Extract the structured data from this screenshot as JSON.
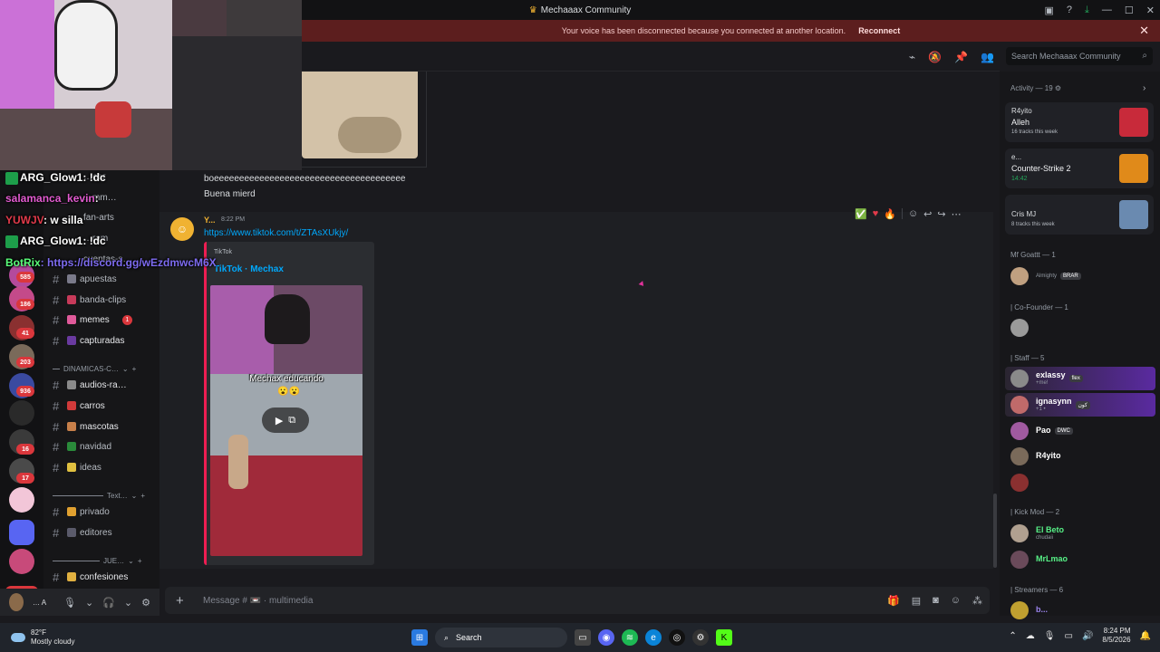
{
  "window": {
    "title": "Mechaaax Community"
  },
  "banner": {
    "message": "Your voice has been disconnected because you connected at another location.",
    "action": "Reconnect"
  },
  "search": {
    "placeholder": "Search Mechaaax Community"
  },
  "stream_chat": [
    {
      "user": "ARG_Glow1",
      "text": ": !dc"
    },
    {
      "user": "salamanca_kevin",
      "text": ":"
    },
    {
      "user": "YUWJV",
      "text": ": w silla"
    },
    {
      "user": "ARG_Glow1",
      "text": ": !dc"
    },
    {
      "user": "BotRix",
      "text": ": https://discord.gg/wEzdmwcM6X"
    }
  ],
  "guild_badges": [
    "585",
    "186",
    "41",
    "203",
    "936",
    "16",
    "17"
  ],
  "guild_new": "NEW",
  "channels": {
    "partial_top": [
      "…ear",
      "…mm…",
      "fan-arts",
      "…ram",
      "cuentas-s…"
    ],
    "items": [
      {
        "name": "apuestas"
      },
      {
        "name": "banda-clips"
      },
      {
        "name": "memes",
        "badge": "1"
      },
      {
        "name": "capturadas"
      },
      {
        "name": "audios-ra…"
      },
      {
        "name": "carros"
      },
      {
        "name": "mascotas"
      },
      {
        "name": "navidad"
      },
      {
        "name": "ideas"
      },
      {
        "name": "privado"
      },
      {
        "name": "editores"
      },
      {
        "name": "confesiones"
      }
    ],
    "categories": [
      "DINAMICAS-C…",
      "Text…",
      "JUE…"
    ]
  },
  "user_panel": {
    "name": "…",
    "sub": "A"
  },
  "messages": {
    "line1": "boeeeeeeeeeeeeeeeeeeeeeeeeeeeeeeeeeeeeee",
    "line2": "Buena mierd",
    "author": "Y...",
    "time": "8:22 PM",
    "url": "https://www.tiktok.com/t/ZTAsXUkjy/",
    "embed_provider": "TikTok",
    "embed_title": "TikTok · Mechax",
    "video_caption": "Mechax educando",
    "video_emoji": "😮😮"
  },
  "composer": {
    "placeholder": "Message # 📼 · multimedia"
  },
  "members": {
    "activity_header": "Activity — 19",
    "activity": [
      {
        "name": "R4yito",
        "game": "Alleh",
        "sub": "16 tracks this week"
      },
      {
        "name": "e...",
        "game": "Counter-Strike 2",
        "sub": "14:42"
      },
      {
        "name": "Cris MJ",
        "game": "",
        "sub": "8 tracks this week"
      }
    ],
    "groups": [
      {
        "title": "Mf Goattt — 1",
        "people": [
          {
            "name": "",
            "status": "Almighty",
            "tag": "BRAR"
          }
        ]
      },
      {
        "title": "| Co-Founder — 1",
        "people": [
          {
            "name": "",
            "status": ""
          }
        ]
      },
      {
        "title": "| Staff — 5",
        "people": [
          {
            "name": "exlassy",
            "status": "+me!",
            "tag": "flex"
          },
          {
            "name": "ignasynn",
            "status": "+1 •",
            "tag": "كون"
          },
          {
            "name": "Pao",
            "status": "",
            "tag": "DWC"
          },
          {
            "name": "R4yito",
            "status": ""
          },
          {
            "name": "",
            "status": ""
          }
        ]
      },
      {
        "title": "| Kick Mod — 2",
        "people": [
          {
            "name": "El Beto",
            "status": "chudaii"
          },
          {
            "name": "MrLmao",
            "status": ""
          }
        ]
      },
      {
        "title": "| Streamers — 6",
        "people": [
          {
            "name": "b...",
            "status": ""
          }
        ]
      }
    ]
  },
  "taskbar": {
    "temp": "82°F",
    "weather": "Mostly cloudy",
    "search": "Search",
    "time": "8:24 PM",
    "date": "8/5/2026"
  }
}
